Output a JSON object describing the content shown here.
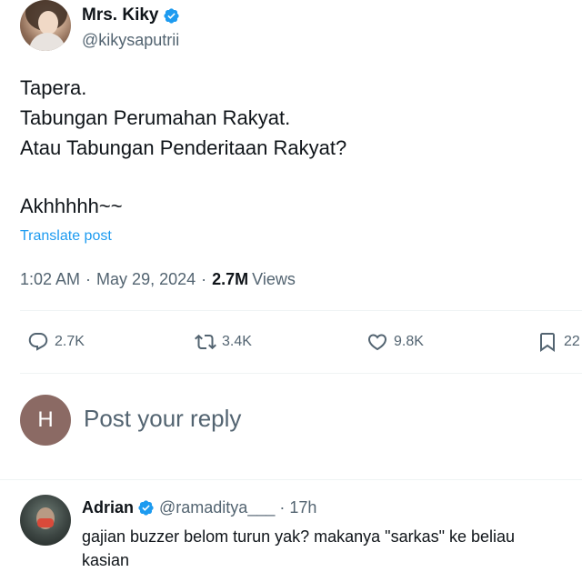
{
  "post": {
    "author": {
      "name": "Mrs. Kiky",
      "handle": "@kikysaputrii",
      "verified": true
    },
    "text_lines": [
      "Tapera.",
      "Tabungan Perumahan Rakyat.",
      "Atau Tabungan Penderitaan Rakyat?",
      "",
      "Akhhhhh~~"
    ],
    "translate_label": "Translate post",
    "time": "1:02 AM",
    "date": "May 29, 2024",
    "views_count": "2.7M",
    "views_label": "Views",
    "separator": "·"
  },
  "actions": {
    "replies": "2.7K",
    "reposts": "3.4K",
    "likes": "9.8K",
    "bookmarks": "22"
  },
  "reply_box": {
    "avatar_letter": "H",
    "placeholder": "Post your reply"
  },
  "reply": {
    "name": "Adrian",
    "handle": "@ramaditya___",
    "separator": "·",
    "time": "17h",
    "text_lines": [
      "gajian buzzer belom turun yak? makanya \"sarkas\" ke beliau",
      "kasian"
    ]
  },
  "colors": {
    "accent": "#1d9bf0",
    "secondary_text": "#536471",
    "primary_text": "#0f1419",
    "reply_avatar_bg": "#8b6a64"
  }
}
